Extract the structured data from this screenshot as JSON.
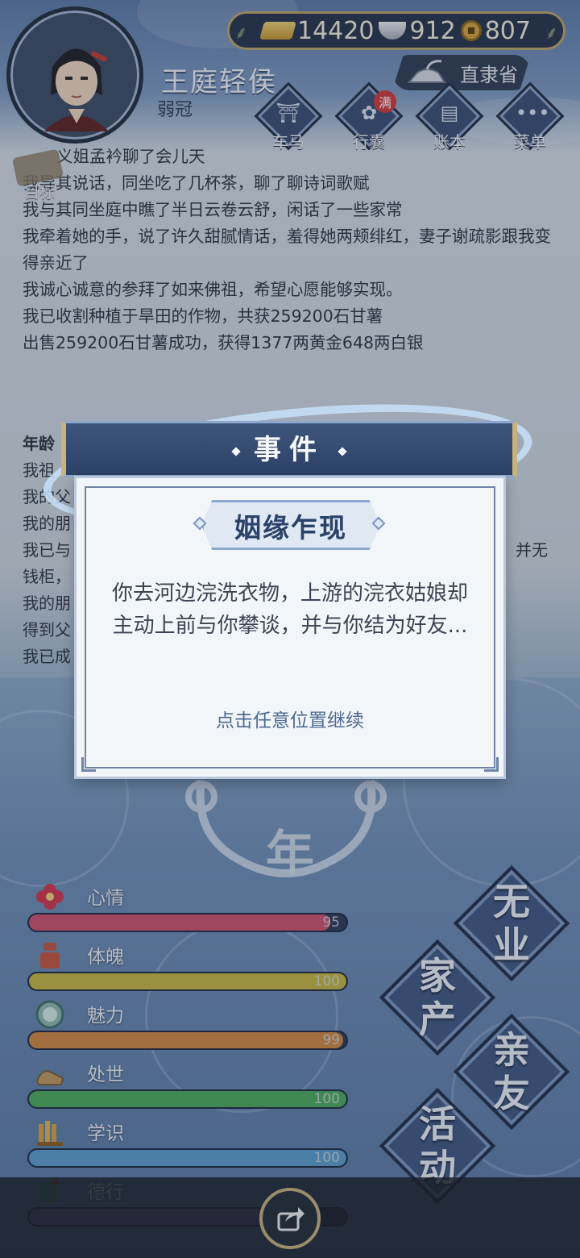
{
  "header": {
    "player_name": "王庭轻侯",
    "player_title": "弱冠",
    "currency": {
      "gold": "14420",
      "silver": "912",
      "coins": "807"
    },
    "province": "直隶省",
    "menu": [
      {
        "label": "车马",
        "badge": ""
      },
      {
        "label": "行囊",
        "badge": "满"
      },
      {
        "label": "账本",
        "badge": ""
      },
      {
        "label": "菜单",
        "badge": ""
      }
    ]
  },
  "goal_label": "目标",
  "log": [
    "义姐孟衿聊了会儿天",
    "我导其说话，同坐吃了几杯茶，聊了聊诗词歌赋",
    "我与其同坐庭中瞧了半日云卷云舒，闲话了一些家常",
    "我牵着她的手，说了许久甜腻情话，羞得她两颊绯红，妻子谢疏影跟我变得亲近了",
    "我诚心诚意的参拜了如来佛祖，希望心愿能够实现。",
    "我已收割种植于旱田的作物，共获259200石甘薯",
    "出售259200石甘薯成功，获得1377两黄金648两白银"
  ],
  "age_section": {
    "title": "年龄",
    "lines": [
      "我祖",
      "我的父",
      "我的朋",
      "我已与",
      "钱柜，",
      "我的朋",
      "得到父",
      "我已成"
    ],
    "right_fragments": [
      "并无"
    ]
  },
  "dialog": {
    "header": "事件",
    "subtitle": "姻缘乍现",
    "message": "你去河边浣洗衣物，上游的浣衣姑娘却主动上前与你攀谈，并与你结为好友...",
    "continue_hint": "点击任意位置继续"
  },
  "year_label": "年",
  "stats": [
    {
      "label": "心情",
      "value": "95",
      "fraction": 0.95,
      "color": "#d0506b",
      "icon": "flower-icon"
    },
    {
      "label": "体魄",
      "value": "100",
      "fraction": 1.0,
      "color": "#c7b741",
      "icon": "body-icon"
    },
    {
      "label": "魅力",
      "value": "99",
      "fraction": 0.99,
      "color": "#d0883d",
      "icon": "mirror-icon"
    },
    {
      "label": "处世",
      "value": "100",
      "fraction": 1.0,
      "color": "#4bab5c",
      "icon": "shoe-icon"
    },
    {
      "label": "学识",
      "value": "100",
      "fraction": 1.0,
      "color": "#5a9fcf",
      "icon": "books-icon"
    },
    {
      "label": "德行",
      "value": "",
      "fraction": 0.9,
      "color": "#8a5cb2",
      "icon": "virtue-icon"
    }
  ],
  "actions": [
    {
      "lines": [
        "无",
        "业"
      ]
    },
    {
      "lines": [
        "家",
        "产"
      ]
    },
    {
      "lines": [
        "亲",
        "友"
      ]
    },
    {
      "lines": [
        "活",
        "动"
      ]
    }
  ]
}
